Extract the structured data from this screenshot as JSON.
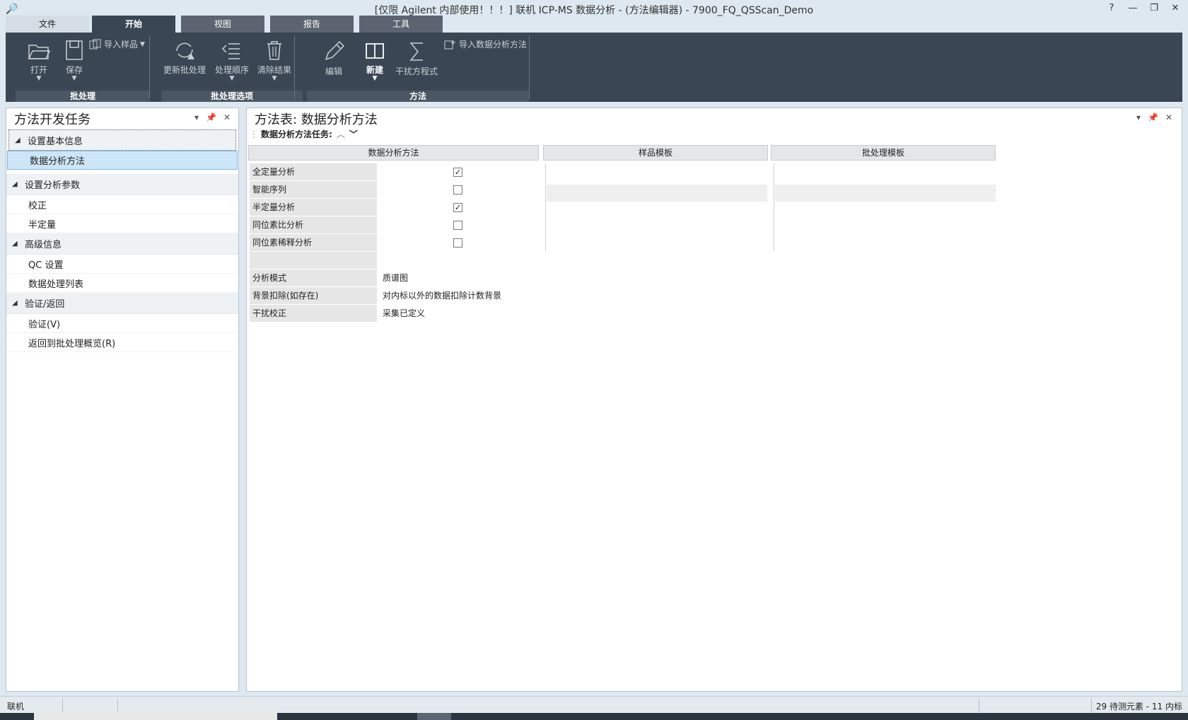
{
  "window": {
    "title": "[仅限 Agilent 内部使用！！！] 联机 ICP-MS 数据分析 - (方法编辑器) - 7900_FQ_QSScan_Demo",
    "help": "?",
    "minimize": "—",
    "restore": "❐",
    "close": "✕"
  },
  "ribbon": {
    "tabs": [
      "文件",
      "开始",
      "视图",
      "报告",
      "工具"
    ],
    "groups": {
      "batch": {
        "label": "批处理",
        "open": "打开",
        "save": "保存",
        "import_sample": "导入样品"
      },
      "batch_options": {
        "label": "批处理选项",
        "update": "更新批处理",
        "order": "处理顺序",
        "clear": "清除结果"
      },
      "method": {
        "label": "方法",
        "edit": "编辑",
        "new": "新建",
        "interference": "干扰方程式",
        "import_method": "导入数据分析方法"
      }
    }
  },
  "left_panel": {
    "title": "方法开发任务",
    "groups": [
      {
        "label": "设置基本信息",
        "items": [
          "数据分析方法"
        ]
      },
      {
        "label": "设置分析参数",
        "items": [
          "校正",
          "半定量"
        ]
      },
      {
        "label": "高级信息",
        "items": [
          "QC 设置",
          "数据处理列表"
        ]
      },
      {
        "label": "验证/返回",
        "items": [
          "验证(V)",
          "返回到批处理概览(R)"
        ]
      }
    ]
  },
  "right_panel": {
    "title": "方法表: 数据分析方法",
    "task_label": "数据分析方法任务:",
    "columns": [
      "数据分析方法",
      "样品模板",
      "批处理模板"
    ],
    "analysis_rows": [
      {
        "label": "全定量分析",
        "checked": true
      },
      {
        "label": "智能序列",
        "checked": false
      },
      {
        "label": "半定量分析",
        "checked": true
      },
      {
        "label": "同位素比分析",
        "checked": false
      },
      {
        "label": "同位素稀释分析",
        "checked": false
      }
    ],
    "settings": [
      {
        "label": "分析模式",
        "value": "质谱图"
      },
      {
        "label": "背景扣除(如存在)",
        "value": "对内标以外的数据扣除计数背景"
      },
      {
        "label": "干扰校正",
        "value": "采集已定义"
      }
    ]
  },
  "status": {
    "mode": "联机",
    "counts": "29 待测元素 - 11 内标"
  }
}
